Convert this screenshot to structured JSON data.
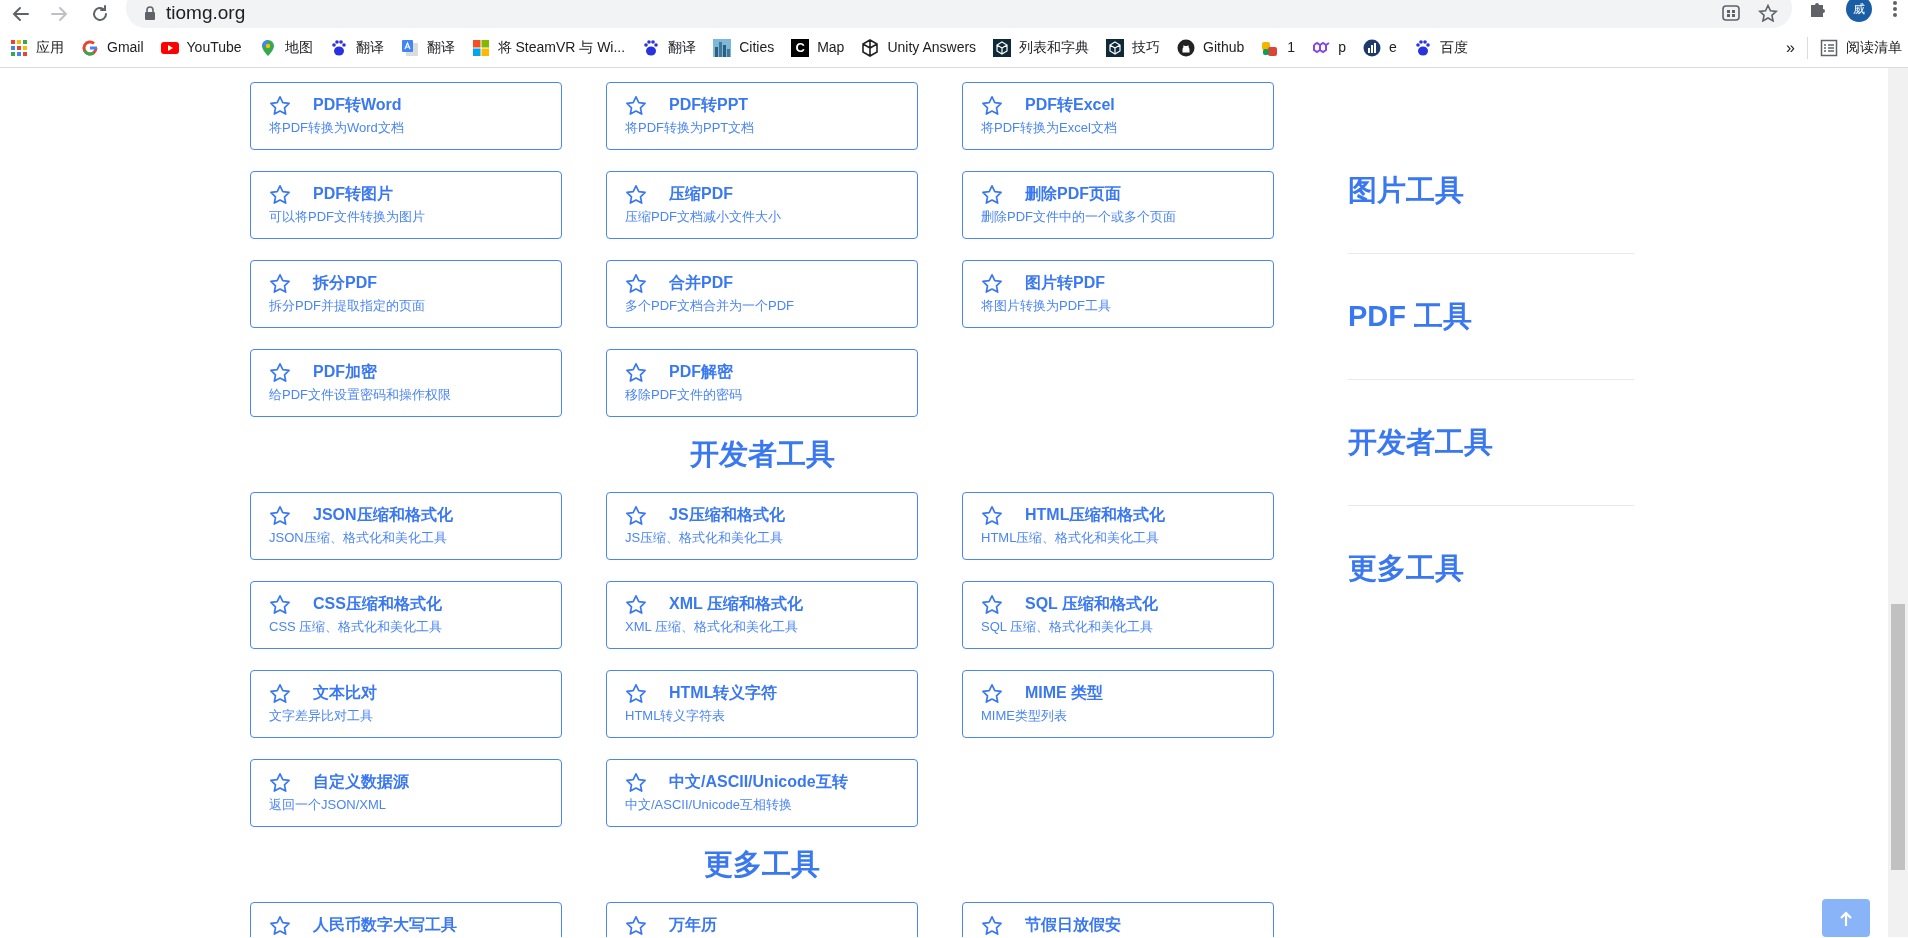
{
  "browser": {
    "url": "tiomg.org",
    "profile_initial": "威",
    "bookmarks": [
      {
        "label": "应用"
      },
      {
        "label": "Gmail"
      },
      {
        "label": "YouTube"
      },
      {
        "label": "地图"
      },
      {
        "label": "翻译"
      },
      {
        "label": "翻译"
      },
      {
        "label": "将 SteamVR 与 Wi..."
      },
      {
        "label": "翻译"
      },
      {
        "label": "Cities"
      },
      {
        "label": "Map",
        "icon_text": "C"
      },
      {
        "label": "Unity Answers"
      },
      {
        "label": "列表和字典"
      },
      {
        "label": "技巧"
      },
      {
        "label": "Github"
      },
      {
        "label": "1"
      },
      {
        "label": "p"
      },
      {
        "label": "e"
      },
      {
        "label": "百度"
      }
    ],
    "overflow": "»",
    "reading_list": "阅读清单"
  },
  "sections": [
    {
      "cards": [
        {
          "title": "PDF转Word",
          "desc": "将PDF转换为Word文档"
        },
        {
          "title": "PDF转PPT",
          "desc": "将PDF转换为PPT文档"
        },
        {
          "title": "PDF转Excel",
          "desc": "将PDF转换为Excel文档"
        },
        {
          "title": "PDF转图片",
          "desc": "可以将PDF文件转换为图片"
        },
        {
          "title": "压缩PDF",
          "desc": "压缩PDF文档减小文件大小"
        },
        {
          "title": "删除PDF页面",
          "desc": "删除PDF文件中的一个或多个页面"
        },
        {
          "title": "拆分PDF",
          "desc": "拆分PDF并提取指定的页面"
        },
        {
          "title": "合并PDF",
          "desc": "多个PDF文档合并为一个PDF"
        },
        {
          "title": "图片转PDF",
          "desc": "将图片转换为PDF工具"
        },
        {
          "title": "PDF加密",
          "desc": "给PDF文件设置密码和操作权限"
        },
        {
          "title": "PDF解密",
          "desc": "移除PDF文件的密码"
        }
      ]
    },
    {
      "title": "开发者工具",
      "cards": [
        {
          "title": "JSON压缩和格式化",
          "desc": "JSON压缩、格式化和美化工具"
        },
        {
          "title": "JS压缩和格式化",
          "desc": "JS压缩、格式化和美化工具"
        },
        {
          "title": "HTML压缩和格式化",
          "desc": "HTML压缩、格式化和美化工具"
        },
        {
          "title": "CSS压缩和格式化",
          "desc": "CSS 压缩、格式化和美化工具"
        },
        {
          "title": "XML 压缩和格式化",
          "desc": "XML 压缩、格式化和美化工具"
        },
        {
          "title": "SQL 压缩和格式化",
          "desc": "SQL 压缩、格式化和美化工具"
        },
        {
          "title": "文本比对",
          "desc": "文字差异比对工具"
        },
        {
          "title": "HTML转义字符",
          "desc": "HTML转义字符表"
        },
        {
          "title": "MIME 类型",
          "desc": "MIME类型列表"
        },
        {
          "title": "自定义数据源",
          "desc": "返回一个JSON/XML"
        },
        {
          "title": "中文/ASCII/Unicode互转",
          "desc": "中文/ASCII/Unicode互相转换"
        }
      ]
    },
    {
      "title": "更多工具",
      "cards": [
        {
          "title": "人民币数字大写工具"
        },
        {
          "title": "万年历"
        },
        {
          "title": "节假日放假安"
        }
      ]
    }
  ],
  "sidebar": {
    "items": [
      "图片工具",
      "PDF 工具",
      "开发者工具",
      "更多工具"
    ]
  }
}
